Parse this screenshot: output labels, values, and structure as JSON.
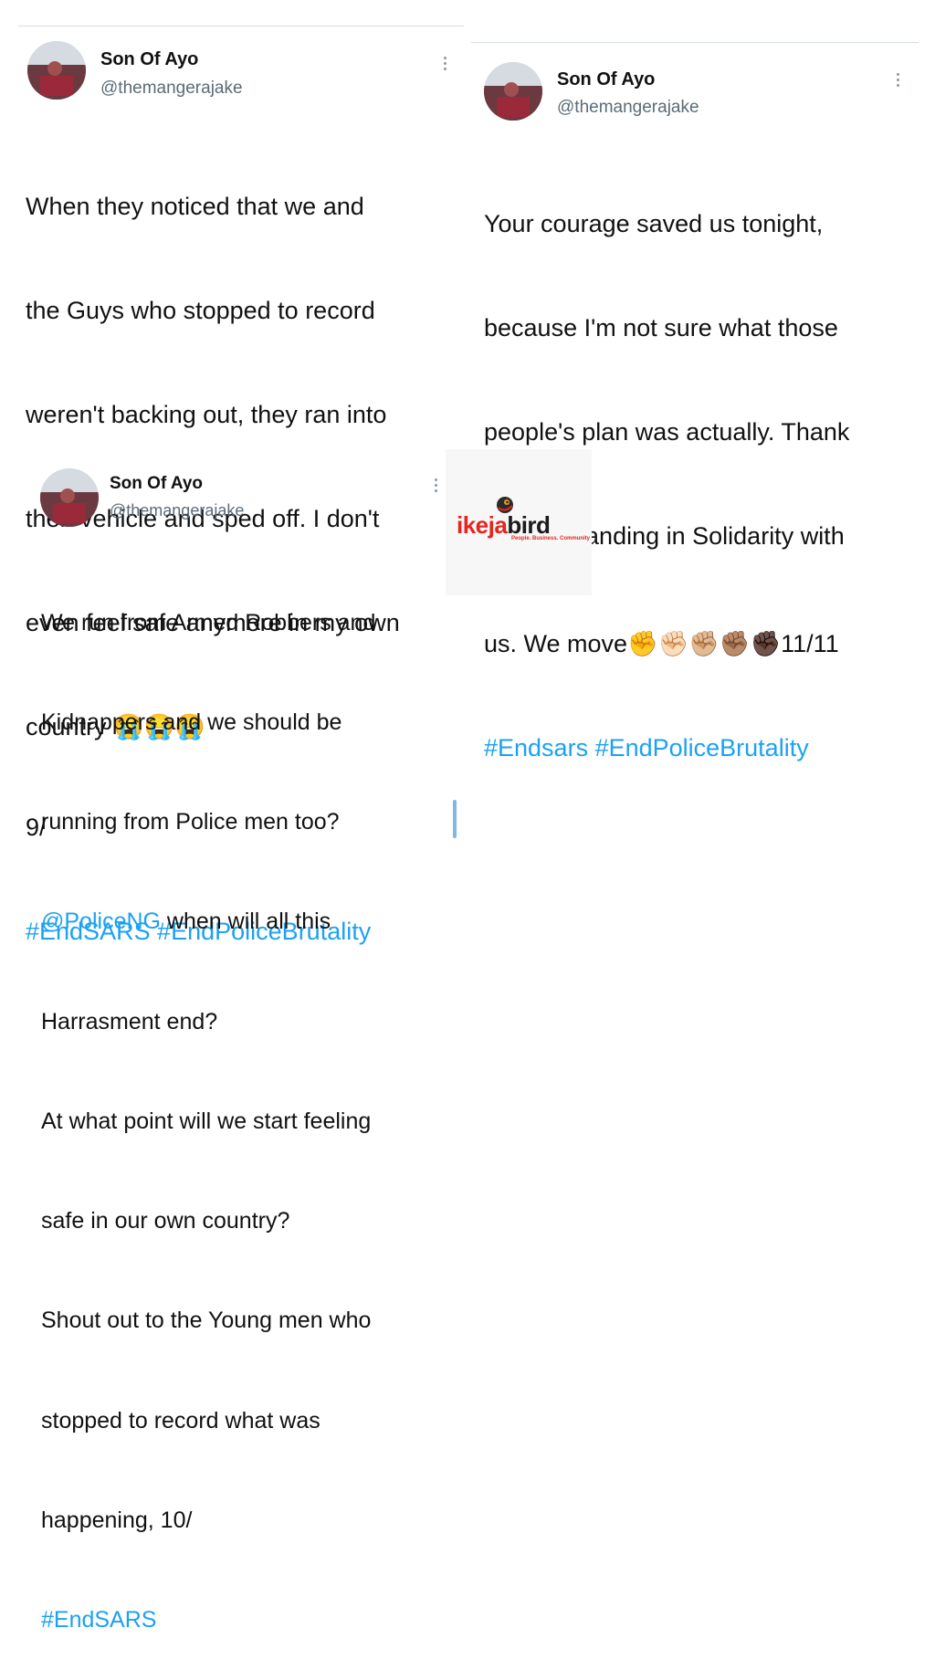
{
  "tweets": [
    {
      "name": "Son Of Ayo",
      "handle": "@themangerajake",
      "lines": [
        "When they noticed that we and",
        "the Guys who stopped to record",
        "weren't backing out, they ran into",
        "their vehicle and sped off. I don't",
        "even feel safe anymore in my own",
        "country 😭😭😭",
        "9/"
      ],
      "hashtags": "#EndSARS #EndPoliceBrutality"
    },
    {
      "name": "Son Of Ayo",
      "handle": "@themangerajake",
      "lines": [
        "Your courage saved us tonight,",
        "because I'm not sure what those",
        "people's plan was actually. Thank",
        "you for standing in Solidarity with",
        "us. We move✊✊🏻✊🏼✊🏽✊🏿11/11"
      ],
      "hashtags": "#Endsars #EndPoliceBrutality"
    },
    {
      "name": "Son Of Ayo",
      "handle": "@themangerajake",
      "line1": "We run from Armed Robbers and",
      "line2": "Kidnappers and we should be",
      "line3": "running from Police men too?",
      "mention": "@PoliceNG",
      "line4_rest": " when will all this",
      "line5": "Harrasment end?",
      "line6": "At what point will we start feeling",
      "line7": "safe in our own country?",
      "line8": "Shout out to the Young men who",
      "line9": "stopped to record what was",
      "line10": "happening, 10/",
      "hashtags": "#EndSARS"
    }
  ],
  "logo": {
    "part1": "ikeja",
    "part2": "bird",
    "tagline": "People. Business. Community",
    "colors": {
      "red": "#e3261f",
      "dark": "#1a1a1a"
    }
  },
  "colors": {
    "link": "#1da1f2",
    "handle": "#5b6b78"
  }
}
